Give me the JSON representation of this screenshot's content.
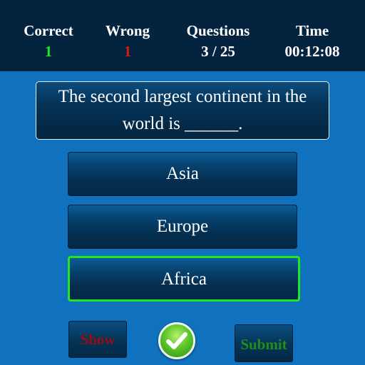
{
  "stats": {
    "correct_label": "Correct",
    "correct_value": "1",
    "wrong_label": "Wrong",
    "wrong_value": "1",
    "questions_label": "Questions",
    "questions_value": "3 / 25",
    "time_label": "Time",
    "time_value": "00:12:08"
  },
  "question": {
    "text": "The second largest continent in the world is ______."
  },
  "options": [
    {
      "label": "Asia"
    },
    {
      "label": "Europe"
    },
    {
      "label": "Africa",
      "selected": true
    }
  ],
  "controls": {
    "show_label": "Show",
    "submit_label": "Submit",
    "check_icon": "check-icon"
  },
  "colors": {
    "correct_value": "#22e622",
    "wrong_value": "#e01515",
    "selected_border": "#22e622",
    "show_text": "#9b0d0d",
    "submit_text": "#1f8e1f"
  }
}
